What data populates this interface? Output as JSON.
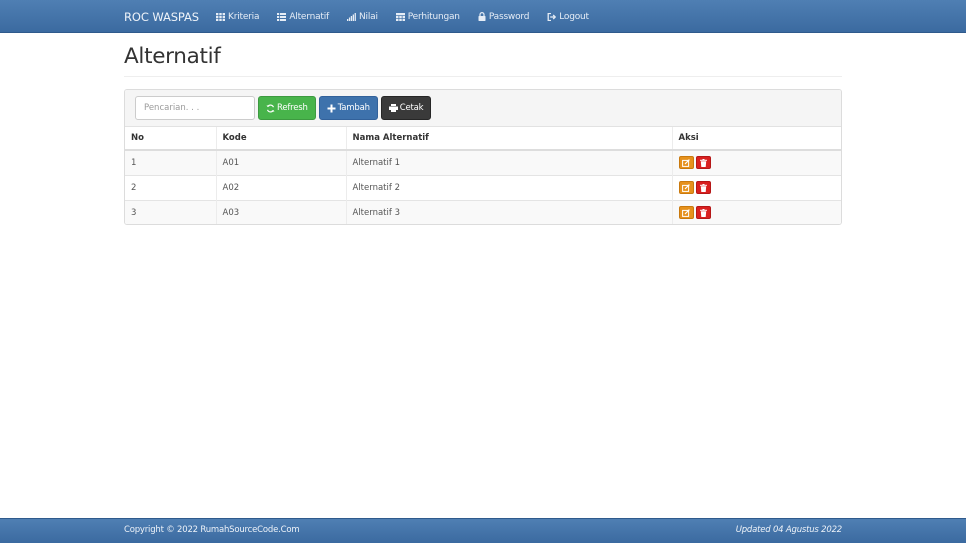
{
  "navbar": {
    "brand": "ROC WASPAS",
    "items": [
      {
        "label": "Kriteria",
        "icon": "grid-icon"
      },
      {
        "label": "Alternatif",
        "icon": "list-icon"
      },
      {
        "label": "Nilai",
        "icon": "signal-icon"
      },
      {
        "label": "Perhitungan",
        "icon": "calculator-icon"
      },
      {
        "label": "Password",
        "icon": "lock-icon"
      },
      {
        "label": "Logout",
        "icon": "logout-icon"
      }
    ]
  },
  "page": {
    "title": "Alternatif"
  },
  "toolbar": {
    "search_placeholder": "Pencarian. . .",
    "search_value": "",
    "refresh_label": "Refresh",
    "add_label": "Tambah",
    "print_label": "Cetak"
  },
  "table": {
    "headers": [
      "No",
      "Kode",
      "Nama Alternatif",
      "Aksi"
    ],
    "rows": [
      {
        "no": "1",
        "kode": "A01",
        "nama": "Alternatif 1"
      },
      {
        "no": "2",
        "kode": "A02",
        "nama": "Alternatif 2"
      },
      {
        "no": "3",
        "kode": "A03",
        "nama": "Alternatif 3"
      }
    ]
  },
  "footer": {
    "copyright": "Copyright © 2022 RumahSourceCode.Com",
    "updated": "Updated 04 Agustus 2022"
  },
  "colors": {
    "navbar": "#3b6aa0",
    "refresh": "#48b44b",
    "add": "#3e72ac",
    "print": "#3a3a3a",
    "edit": "#e6911c",
    "delete": "#d92020"
  }
}
